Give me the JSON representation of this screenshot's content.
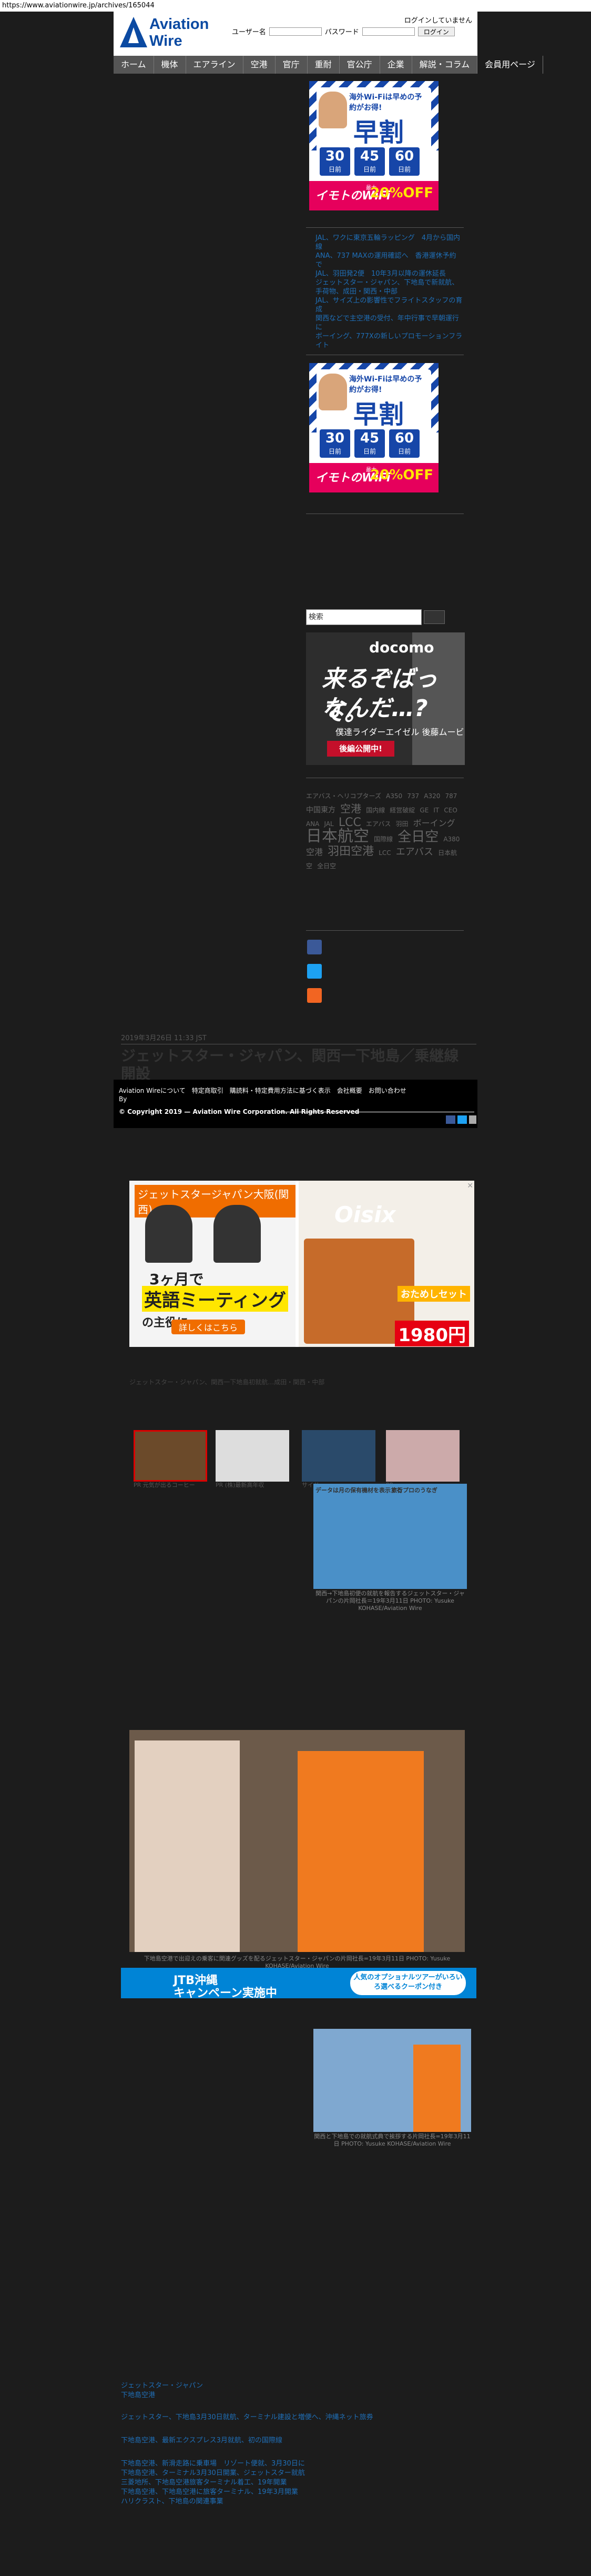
{
  "browser": {
    "url": "https://www.aviationwire.jp/archives/165044"
  },
  "header": {
    "logo_line1": "Aviation",
    "logo_line2": "Wire",
    "login_status": "ログインしていません",
    "username_label": "ユーザー名",
    "password_label": "パスワード",
    "login_button": "ログイン"
  },
  "nav": {
    "items": [
      "ホーム",
      "機体",
      "エアライン",
      "空港",
      "官庁",
      "重耐",
      "官公庁",
      "企業",
      "解説・コラム",
      "会員用ページ"
    ]
  },
  "ad_early": {
    "sub": "海外Wi-Fiは早めの予約がお得!",
    "headline": "早割",
    "days": [
      "30",
      "45",
      "60"
    ],
    "day_unit": "日前",
    "brand": "イモトのWiFi",
    "max_label": "最大",
    "discount": "20%OFF"
  },
  "sidebar": {
    "links": [
      "JAL、ワクに東京五輪ラッピング　4月から国内線",
      "ANA、737 MAXの運用確認へ　香港運休予約で",
      "JAL、羽田発2便　10年3月以降の運休延長",
      "ジェットスター・ジャパン、下地島で新就航、手荷物、成田・関西・中部",
      "JAL、サイズ上の影響性でフライトスタッフの育成",
      "関西などで主空港の受付、年中行事で早朝運行に",
      "ボーイング、777Xの新しいプロモーションフライト"
    ],
    "search_placeholder": "検索",
    "docomo": {
      "logo": "docomo",
      "line1": "来るぞばって。",
      "line2": "なんだ…?",
      "caption": "僕達ライダーエイゼル 後藤ムービー",
      "button": "後編公開中!"
    },
    "tags": [
      "エアバス・ヘリコプターズ",
      "A350",
      "737",
      "A320",
      "787",
      "中国東方",
      "国内線",
      "経営破綻",
      "GE",
      "IT",
      "CEO",
      "ANA",
      "JAL",
      "エアバス",
      "羽田",
      "国際線",
      "A380",
      "空港",
      "LCC",
      "日本航空",
      "全日空",
      "JTA",
      "成田",
      "中部",
      "関西",
      "777",
      "ボーイング",
      "日本航空",
      "羽田空港",
      "関西空港",
      "全日空",
      "ANAホールディングス",
      "747",
      "成田空港",
      "中部空港",
      "エアバス"
    ],
    "tag_big_1": "LCC",
    "tag_big_2": "日本航空",
    "tag_big_3": "全日空",
    "tag_big_4": "羽田空港",
    "tag_mid_1": "空港",
    "tag_mid_2": "ボーイング",
    "tag_mid_3": "エアバス"
  },
  "post": {
    "meta": "2019年3月26日 11:33 JST",
    "title": "ジェットスター・ジャパン、関西一下地島／乗継線開設"
  },
  "footer": {
    "links": "Aviation Wireについて　特定商取引　購読料・特定費用方法に基づく表示　会社概要　お問い合わせ",
    "by": "By",
    "copyright": "© Copyright 2019 — Aviation Wire Corporation. All Rights Reserved"
  },
  "ad_english": {
    "top": "ジェットスタージャパン大阪(関西)",
    "months": "3ヶ月で",
    "meeting": "英語ミーティング",
    "aim": "の主役に。",
    "detail": "詳しくはこちら",
    "brand": "Oisix",
    "promo": "おためしセット",
    "price": "1980円"
  },
  "recs": {
    "strip": "ジェットスター・ジャパン、関西一下地島初就航…成田・関西・中部",
    "captions": [
      "PR 元気が出るコーヒー",
      "PR (株)最新高年収",
      "サイド",
      "PR",
      "データは月の保有機材を表示する",
      "旅行プロのうなぎ"
    ],
    "photo_caption": "関西→下地島初便の就航を報告するジェットスター・ジャパンの片岡社長＝19年3月11日 PHOTO: Yusuke KOHASE/Aviation Wire"
  },
  "big_photo_caption": "下地島空港で出迎えの乗客に関連グッズを配るジェットスター・ジャパンの片岡社長=19年3月11日 PHOTO: Yusuke KOHASE/Aviation Wire",
  "banner_jtb": {
    "line1": "JTB沖縄",
    "line2": "キャンペーン実施中",
    "right": "人気のオプショナルツアーがいろいろ選べるクーポン付き"
  },
  "small_photo_caption": "関西と下地島での就航式典で挨拶する片岡社長=19年3月11日 PHOTO: Yusuke KOHASE/Aviation Wire",
  "bottom_links": {
    "title1": "ジェットスター・ジャパン",
    "title2": "下地島空港",
    "l1": "ジェットスター、下地島3月30日就航、ターミナル建設と増便へ、沖縄ネット旅券",
    "l2": "下地島空港、最新エクスプレス3月就航、初の国際線",
    "l3": "下地島空港、新滑走路に乗車場　リゾート便就、3月30日に",
    "l4": "下地島空港、ターミナル3月30日開業、ジェットスター就航",
    "l5": "三菱地所、下地島空港旅客ターミナル着工、19年開業",
    "l6": "下地島空港、下地島空港に旅客ターミナル、19年3月開業",
    "l7": "ハリクラスト、下地島の関連事業"
  },
  "colors": {
    "link": "#1f6fb8",
    "nav": "#555555",
    "accent_pink": "#e6005c",
    "brand_blue": "#0b4aa2"
  }
}
